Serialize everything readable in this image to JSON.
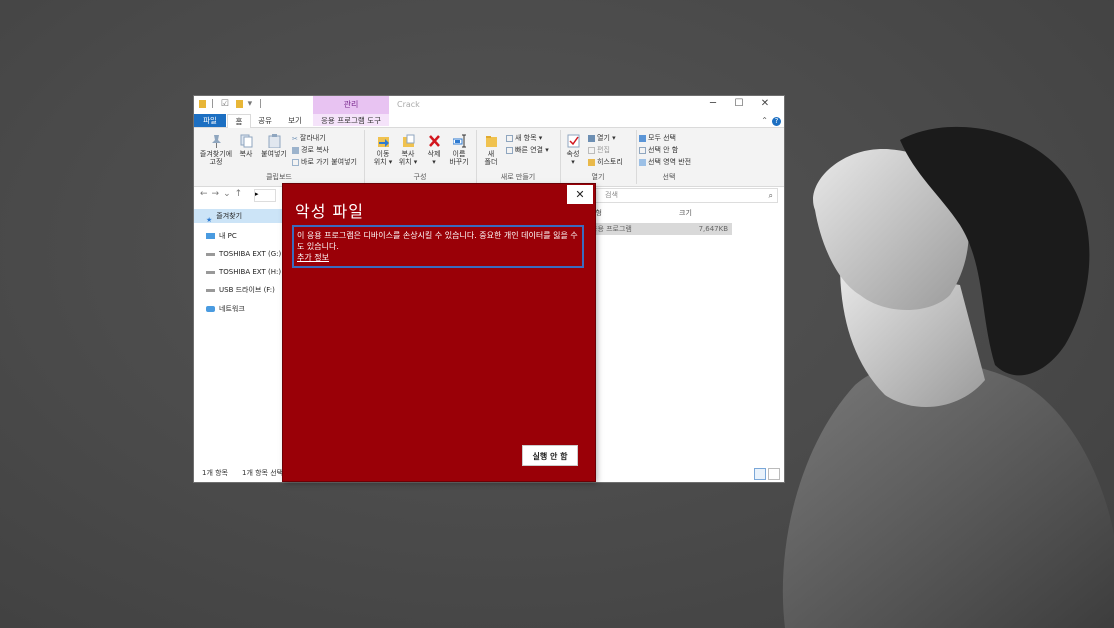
{
  "explorer": {
    "window_title": "Crack",
    "context_tab": "관리",
    "tabs": [
      "파일",
      "홈",
      "공유",
      "보기",
      "응용 프로그램 도구"
    ],
    "ribbon": {
      "clipboard": {
        "pin_label_1": "즐겨찾기에",
        "pin_label_2": "고정",
        "copy": "복사",
        "paste": "붙여넣기",
        "cut": "잘라내기",
        "copy_path": "경로 복사",
        "paste_shortcut": "바로 가기 붙여넣기",
        "group": "클립보드"
      },
      "organize": {
        "move_1": "이동",
        "move_2": "위치 ▾",
        "copyto_1": "복사",
        "copyto_2": "위치 ▾",
        "delete_1": "삭제",
        "delete_2": "▾",
        "rename_1": "이름",
        "rename_2": "바꾸기",
        "group": "구성"
      },
      "new": {
        "new_folder_1": "새",
        "new_folder_2": "폴더",
        "new_item": "새 항목 ▾",
        "easy_access": "빠른 연결 ▾",
        "group": "새로 만들기"
      },
      "open": {
        "properties": "속성",
        "properties_2": "▾",
        "open": "열기 ▾",
        "edit": "편집",
        "history": "히스토리",
        "group": "열기"
      },
      "select": {
        "select_all": "모두 선택",
        "select_none": "선택 안 함",
        "invert": "선택 영역 반전",
        "group": "선택"
      }
    },
    "address_crumb": "▸",
    "search_placeholder": "검색",
    "nav": {
      "quick_access": "즐겨찾기",
      "this_pc": "내 PC",
      "drive_g": "TOSHIBA EXT (G:)",
      "drive_h": "TOSHIBA EXT (H:)",
      "drive_f": "USB 드라이브 (F:)",
      "network": "네트워크"
    },
    "columns": {
      "type": "유형",
      "size": "크기"
    },
    "file_row": {
      "type": "응용 프로그램",
      "size": "7,647KB"
    },
    "status": {
      "count": "1개 항목",
      "selected": "1개 항목 선택"
    }
  },
  "dialog": {
    "title": "악성 파일",
    "message": "이 응용 프로그램은 디바이스를 손상시킬 수 있습니다. 중요한 개인 데이터를 잃을 수도 있습니다.",
    "more_info": "추가 정보",
    "close": "✕",
    "dont_run": "실행 안 함"
  },
  "colors": {
    "dialog_bg": "#9a0007",
    "focus_border": "#3a6bbf",
    "file_tab": "#1c6fc2",
    "context_tab": "#e8c3f2"
  }
}
